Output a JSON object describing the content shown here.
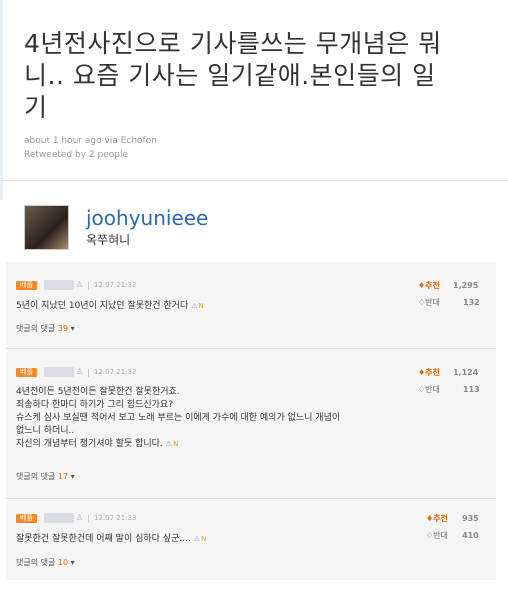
{
  "tweet": {
    "lines": [
      "4년전사진으로 기사를쓰는 무개념은 뭐",
      "니.. 요즘 기사는 일기같애.본인들의 일",
      "기"
    ],
    "meta_time": "about 1 hour ago via Echofon",
    "meta_retweet": "Retweeted by 2 people",
    "handle": "joohyunieee",
    "real_name": "옥쭈혀니"
  },
  "comments": [
    {
      "badge": "베플",
      "date": "12.07 21:32",
      "lines": [
        "5년이 지났던 10년이 지났던 잘못한건 한거다"
      ],
      "reply_label": "댓글의 댓글",
      "reply_count": "39",
      "recommend_label": "추천",
      "recommend_count": "1,295",
      "oppose_label": "반대",
      "oppose_count": "132"
    },
    {
      "badge": "베플",
      "date": "12.07 21:32",
      "lines": [
        "4년전이든 5년전이든 잘못한건 잘못한거죠.",
        "죄송하다 한마디 하기가 그리 힘드신가요?",
        "슈스케 심사 보실땐 적어서 보고 노래 부르는 이에게 가수에 대한 예의가 없느니 개념이",
        "없느니 하더니..",
        "자신의 개념부터 챙기셔야 할듯 합니다."
      ],
      "reply_label": "댓글의 댓글",
      "reply_count": "17",
      "recommend_label": "추천",
      "recommend_count": "1,124",
      "oppose_label": "반대",
      "oppose_count": "113"
    },
    {
      "badge": "베플",
      "date": "12.07 21:33",
      "lines": [
        "잘못한건 잘못한건데 어째 말이 심하다 싶군...."
      ],
      "reply_label": "댓글의 댓글",
      "reply_count": "10",
      "recommend_label": "추천",
      "recommend_count": "935",
      "oppose_label": "반대",
      "oppose_count": "410"
    }
  ],
  "icons": {
    "recommend": "thumbs-up-icon",
    "oppose": "thumbs-down-icon",
    "user": "user-icon",
    "report": "report-icon",
    "reply_more": "chevron-down-icon"
  }
}
